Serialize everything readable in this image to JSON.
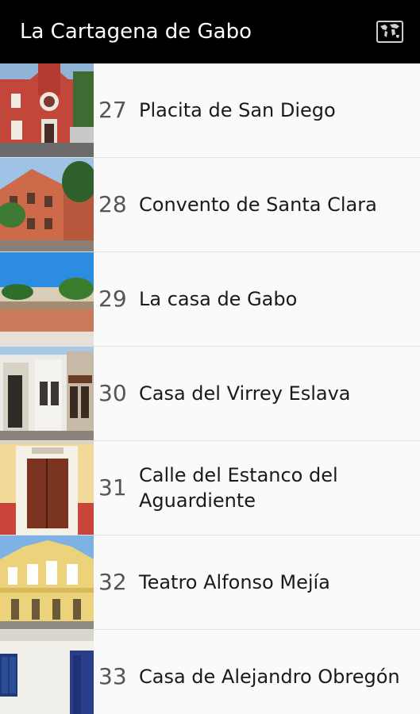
{
  "app": {
    "title": "La Cartagena de Gabo",
    "map_icon": "world-map-icon",
    "colors": {
      "action_bar": "#000000",
      "list_background": "#fafafa",
      "divider": "#e0e0e0"
    }
  },
  "places": [
    {
      "number": "27",
      "name": "Placita de San Diego",
      "thumbnail": "red-church-facade"
    },
    {
      "number": "28",
      "name": "Convento de Santa Clara",
      "thumbnail": "terracotta-convent"
    },
    {
      "number": "29",
      "name": "La casa de Gabo",
      "thumbnail": "house-wall-palms"
    },
    {
      "number": "30",
      "name": "Casa del Virrey Eslava",
      "thumbnail": "colonial-street-balconies"
    },
    {
      "number": "31",
      "name": "Calle del Estanco del Aguardiente",
      "thumbnail": "yellow-door-facade"
    },
    {
      "number": "32",
      "name": "Teatro Alfonso Mejía",
      "thumbnail": "yellow-theatre-facade"
    },
    {
      "number": "33",
      "name": "Casa de Alejandro Obregón",
      "thumbnail": "white-house-blue-door"
    }
  ]
}
